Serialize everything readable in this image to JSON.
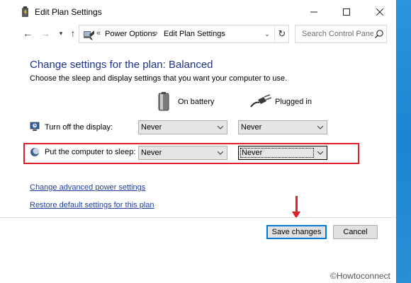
{
  "window": {
    "title": "Edit Plan Settings",
    "controls": {
      "minimize": "—",
      "maximize": "☐",
      "close": "✕"
    }
  },
  "nav": {
    "back": "←",
    "forward": "→",
    "history": "▾",
    "up": "↑",
    "breadcrumb_prefix": "«",
    "breadcrumbs": [
      "Power Options",
      "Edit Plan Settings"
    ],
    "breadcrumb_separator": "›",
    "address_dropdown": "⌄",
    "refresh": "↻",
    "search_placeholder": "Search Control Panel"
  },
  "main": {
    "heading": "Change settings for the plan: Balanced",
    "subheading": "Choose the sleep and display settings that you want your computer to use.",
    "columns": {
      "battery": "On battery",
      "plugged": "Plugged in"
    },
    "rows": [
      {
        "label": "Turn off the display:",
        "battery": "Never",
        "plugged": "Never",
        "icon": "monitor-icon"
      },
      {
        "label": "Put the computer to sleep:",
        "battery": "Never",
        "plugged": "Never",
        "icon": "moon-sleep-icon"
      }
    ],
    "links": {
      "advanced": "Change advanced power settings",
      "restore": "Restore default settings for this plan"
    }
  },
  "footer": {
    "save": "Save changes",
    "cancel": "Cancel"
  },
  "watermark": "©Howtoconnect",
  "colors": {
    "heading": "#1e3287",
    "link": "#1f3e9c",
    "highlight": "#e0202a",
    "desktop": "#1e8fd8"
  }
}
